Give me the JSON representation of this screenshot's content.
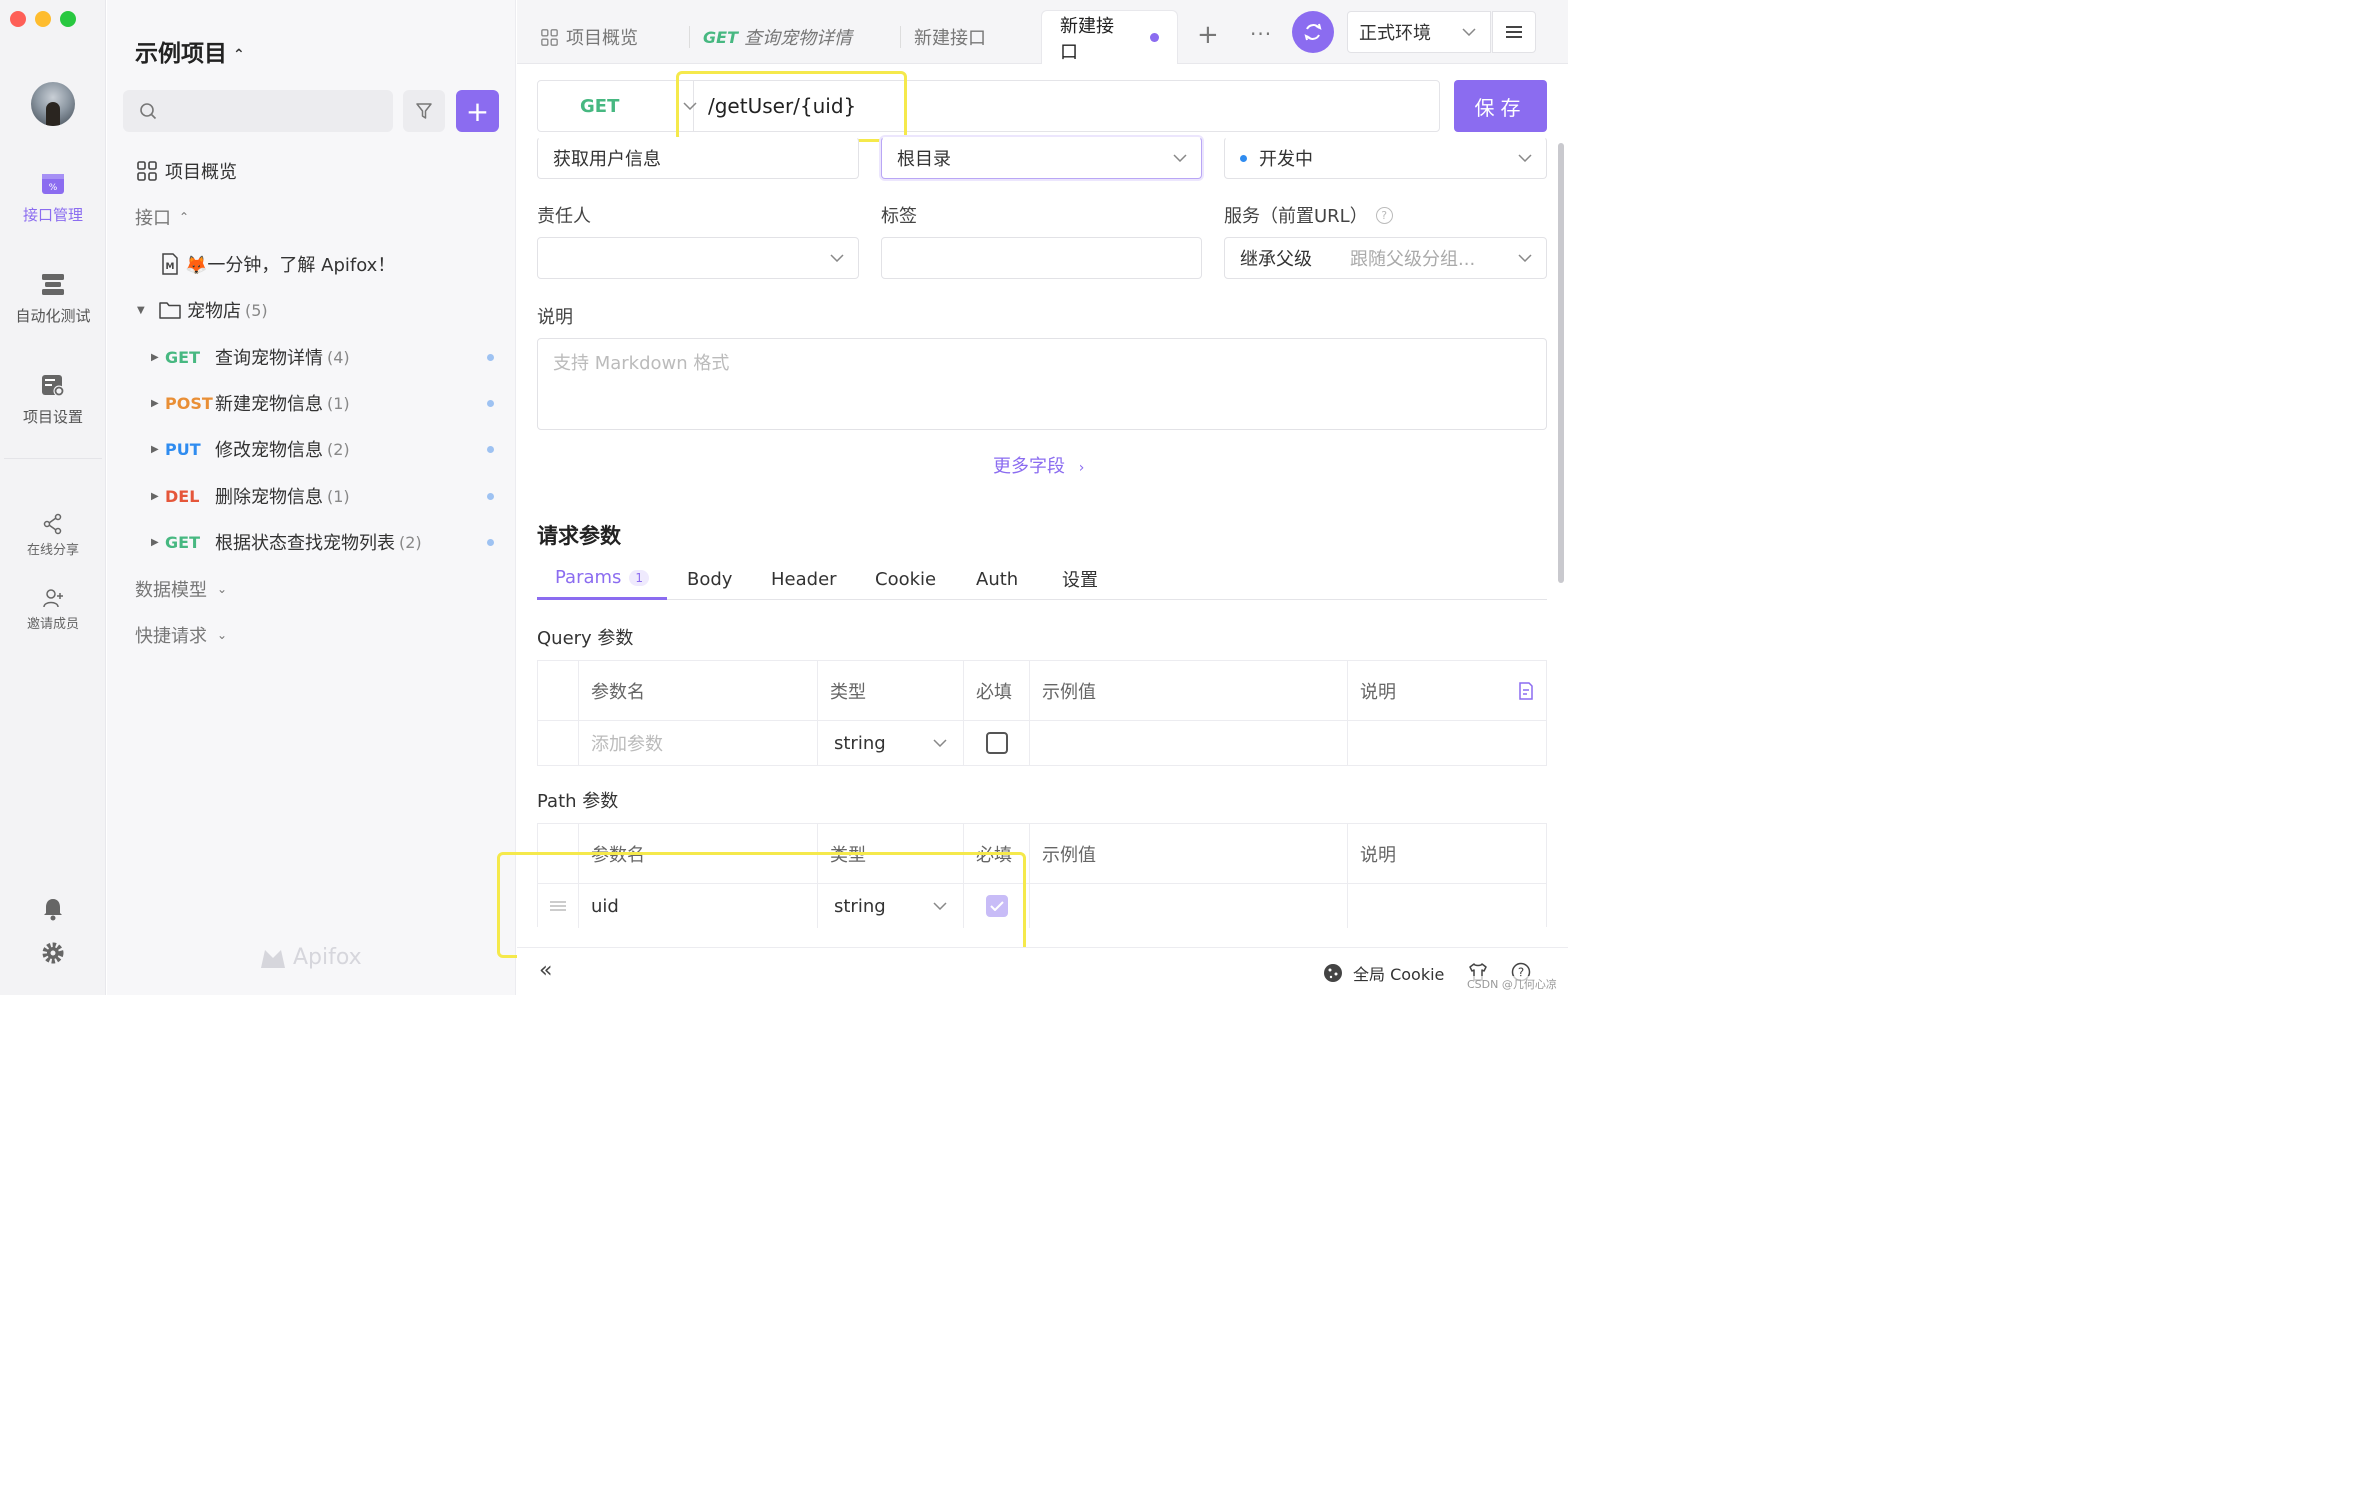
{
  "rail": {
    "items": [
      {
        "label": "接口管理",
        "icon": "api-icon"
      },
      {
        "label": "自动化测试",
        "icon": "test-icon"
      },
      {
        "label": "项目设置",
        "icon": "settings-icon"
      }
    ],
    "share": "在线分享",
    "invite": "邀请成员"
  },
  "sidebar": {
    "project_title": "示例项目",
    "overview": "项目概览",
    "apis_section": "接口",
    "intro_doc": "🦊一分钟，了解 Apifox！",
    "folder": {
      "name": "宠物店",
      "count": "(5)"
    },
    "endpoints": [
      {
        "method": "GET",
        "name": "查询宠物详情",
        "count": "(4)"
      },
      {
        "method": "POST",
        "name": "新建宠物信息",
        "count": "(1)"
      },
      {
        "method": "PUT",
        "name": "修改宠物信息",
        "count": "(2)"
      },
      {
        "method": "DEL",
        "name": "删除宠物信息",
        "count": "(1)"
      },
      {
        "method": "GET",
        "name": "根据状态查找宠物列表",
        "count": "(2)"
      }
    ],
    "models_section": "数据模型",
    "quick_section": "快捷请求",
    "watermark": "Apifox"
  },
  "tabs": {
    "overview": "项目概览",
    "get_method": "GET",
    "get_name": "查询宠物详情",
    "new1": "新建接口",
    "new2": "新建接口",
    "env": "正式环境"
  },
  "request": {
    "method": "GET",
    "path": "/getUser/{uid}",
    "save": "保存",
    "name": "获取用户信息",
    "directory": "根目录",
    "status": "开发中",
    "owner_label": "责任人",
    "tags_label": "标签",
    "service_label": "服务（前置URL）",
    "service_value": "继承父级",
    "service_hint": "跟随父级分组...",
    "desc_label": "说明",
    "desc_placeholder": "支持 Markdown 格式",
    "more_fields": "更多字段"
  },
  "params": {
    "title": "请求参数",
    "tabs": [
      "Params",
      "Body",
      "Header",
      "Cookie",
      "Auth",
      "设置"
    ],
    "params_badge": "1",
    "query_title": "Query 参数",
    "path_title": "Path 参数",
    "headers": [
      "参数名",
      "类型",
      "必填",
      "示例值",
      "说明"
    ],
    "query_row": {
      "name_placeholder": "添加参数",
      "type": "string"
    },
    "path_row": {
      "name": "uid",
      "type": "string"
    }
  },
  "footer": {
    "cookie": "全局 Cookie",
    "credit": "CSDN @几何心凉"
  },
  "colors": {
    "accent": "#8b6cf0",
    "get": "#47b881",
    "post": "#e98f36",
    "put": "#2f8cf0",
    "del": "#e5563a",
    "highlight": "#f5e94b"
  }
}
